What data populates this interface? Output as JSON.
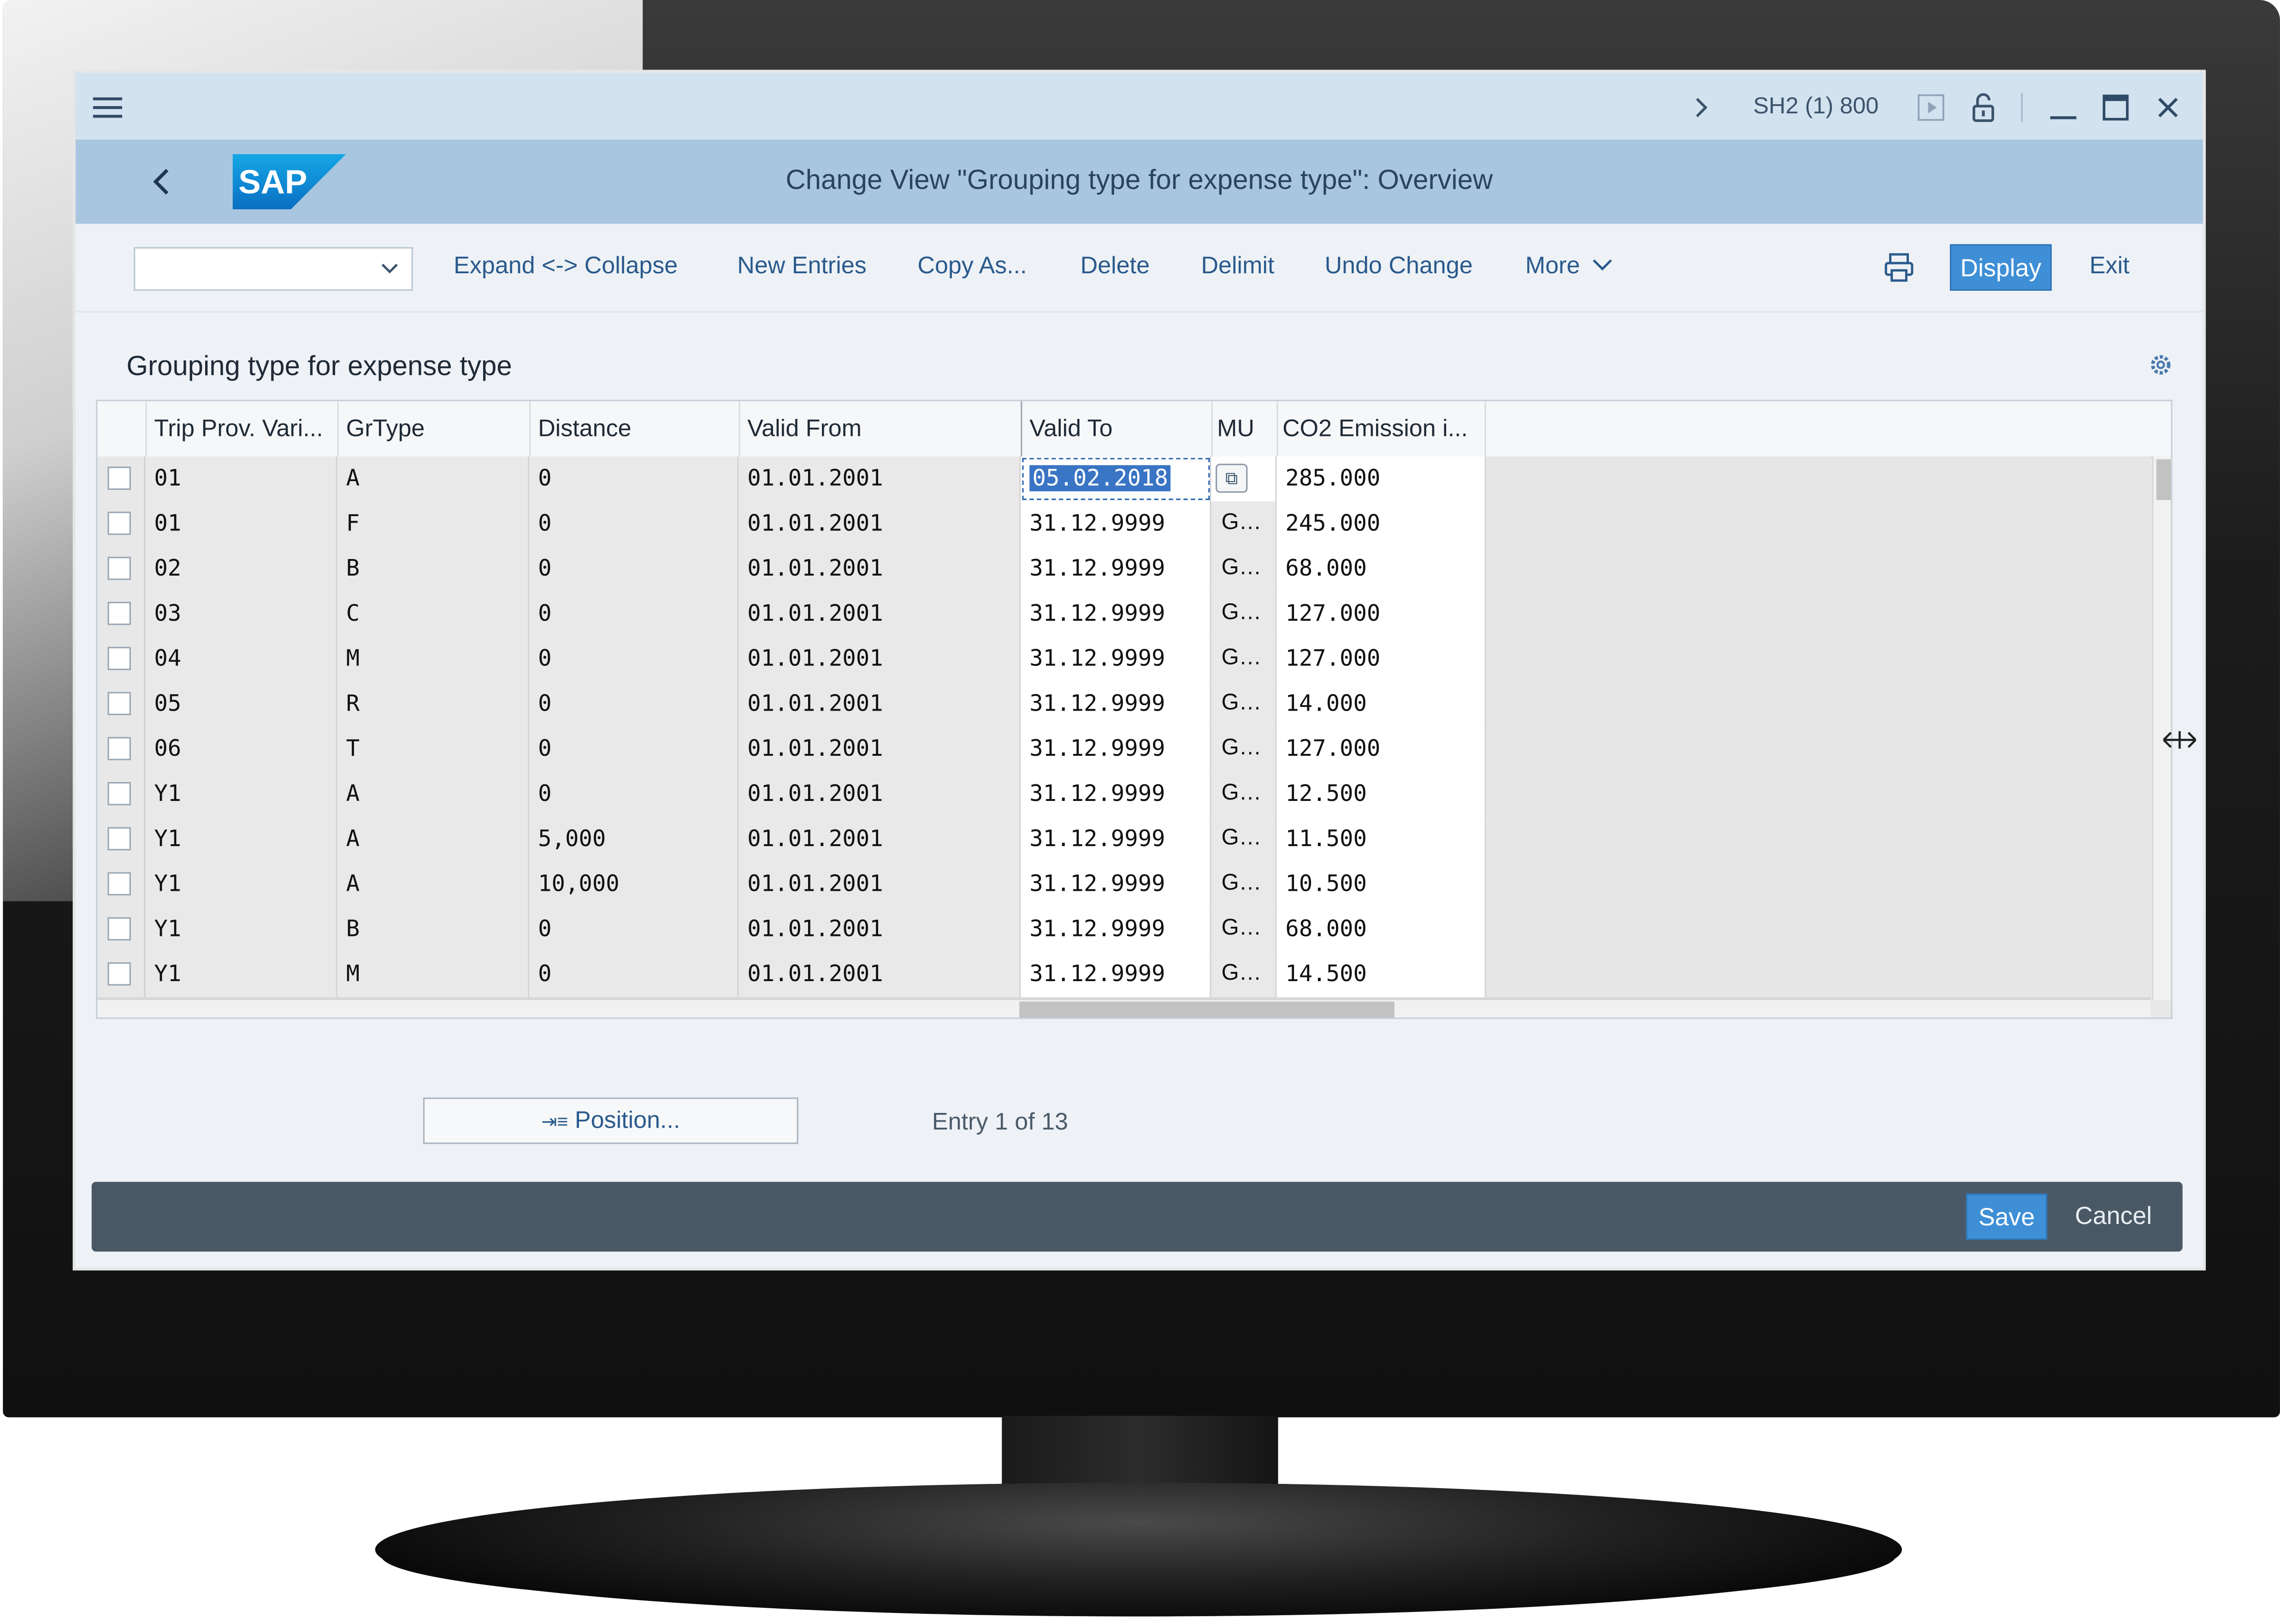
{
  "window": {
    "system_label": "SH2 (1) 800",
    "title": "Change View \"Grouping type for expense type\": Overview"
  },
  "toolbar": {
    "dropdown_value": "",
    "buttons": [
      "Expand <-> Collapse",
      "New Entries",
      "Copy As...",
      "Delete",
      "Delimit",
      "Undo Change",
      "More"
    ],
    "display_label": "Display",
    "exit_label": "Exit"
  },
  "section": {
    "title": "Grouping type for expense type"
  },
  "table": {
    "columns": [
      "Trip Prov. Vari...",
      "GrType",
      "Distance",
      "Valid From",
      "Valid To",
      "MU",
      "CO2 Emission i..."
    ],
    "rows": [
      [
        "01",
        "A",
        "0",
        "01.01.2001",
        "05.02.2018",
        "",
        "285.000"
      ],
      [
        "01",
        "F",
        "0",
        "01.01.2001",
        "31.12.9999",
        "G…",
        "245.000"
      ],
      [
        "02",
        "B",
        "0",
        "01.01.2001",
        "31.12.9999",
        "G…",
        "68.000"
      ],
      [
        "03",
        "C",
        "0",
        "01.01.2001",
        "31.12.9999",
        "G…",
        "127.000"
      ],
      [
        "04",
        "M",
        "0",
        "01.01.2001",
        "31.12.9999",
        "G…",
        "127.000"
      ],
      [
        "05",
        "R",
        "0",
        "01.01.2001",
        "31.12.9999",
        "G…",
        "14.000"
      ],
      [
        "06",
        "T",
        "0",
        "01.01.2001",
        "31.12.9999",
        "G…",
        "127.000"
      ],
      [
        "Y1",
        "A",
        "0",
        "01.01.2001",
        "31.12.9999",
        "G…",
        "12.500"
      ],
      [
        "Y1",
        "A",
        "5,000",
        "01.01.2001",
        "31.12.9999",
        "G…",
        "11.500"
      ],
      [
        "Y1",
        "A",
        "10,000",
        "01.01.2001",
        "31.12.9999",
        "G…",
        "10.500"
      ],
      [
        "Y1",
        "B",
        "0",
        "01.01.2001",
        "31.12.9999",
        "G…",
        "68.000"
      ],
      [
        "Y1",
        "M",
        "0",
        "01.01.2001",
        "31.12.9999",
        "G…",
        "14.500"
      ]
    ]
  },
  "position_button": "Position...",
  "entry_info": "Entry 1 of 13",
  "footer": {
    "save_label": "Save",
    "cancel_label": "Cancel"
  },
  "colors": {
    "header_bg": "#a9c6e0",
    "titlebar_bg": "#d3e2ef",
    "accent_button": "#3e8fd6",
    "footer_bg": "#4a5866",
    "link_text": "#2a5a8c"
  },
  "icons": [
    "menu-icon",
    "chevron-right-icon",
    "play-icon",
    "unlock-icon",
    "minimize-icon",
    "maximize-icon",
    "close-icon",
    "back-icon",
    "sap-logo",
    "chevron-down-icon",
    "print-icon",
    "settings-icon",
    "value-help-icon",
    "resize-cursor-icon",
    "position-icon"
  ]
}
